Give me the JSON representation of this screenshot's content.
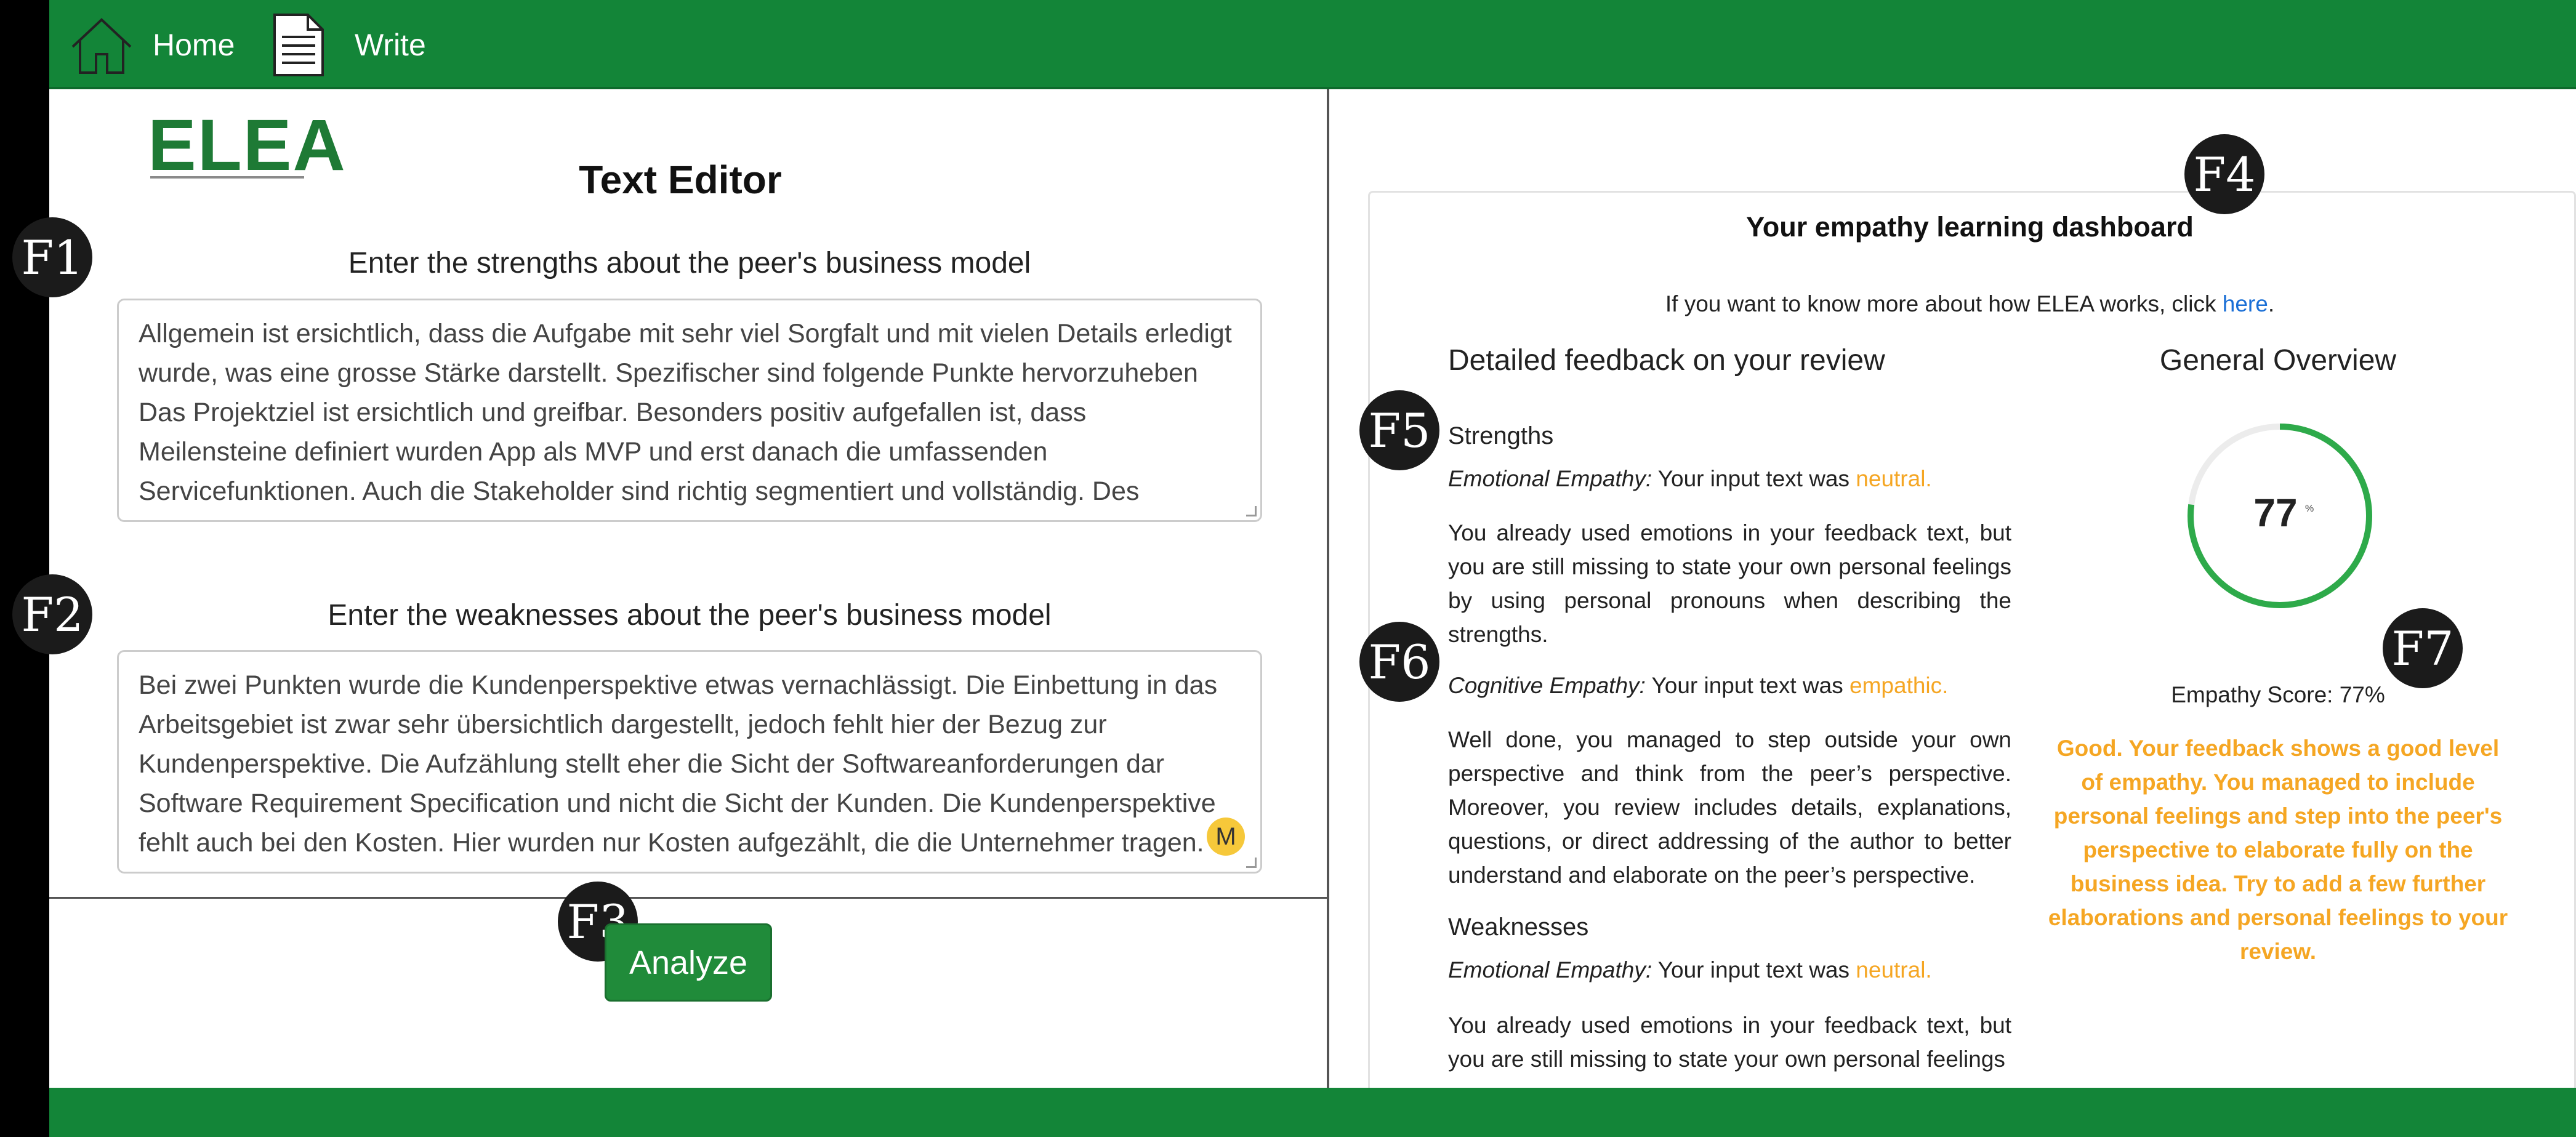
{
  "nav": {
    "home_label": "Home",
    "write_label": "Write"
  },
  "logo": {
    "text": "ELEA"
  },
  "editor": {
    "title": "Text Editor",
    "strengths_label": "Enter the strengths about the peer's business model",
    "strengths_text": "Allgemein ist ersichtlich, dass die Aufgabe mit sehr viel Sorgfalt und mit vielen Details erledigt wurde, was eine grosse Stärke darstellt. Spezifischer sind folgende Punkte hervorzuheben Das Projektziel ist ersichtlich und greifbar. Besonders positiv aufgefallen ist, dass Meilensteine definiert wurden App als MVP und erst danach die umfassenden Servicefunktionen. Auch die Stakeholder sind richtig segmentiert und vollständig. Des",
    "weaknesses_label": "Enter the weaknesses about the peer's business model",
    "weaknesses_text": "Bei zwei Punkten wurde die Kundenperspektive etwas vernachlässigt. Die Einbettung in das Arbeitsgebiet ist zwar sehr übersichtlich dargestellt, jedoch fehlt hier der Bezug zur Kundenperspektive. Die Aufzählung stellt eher die Sicht der Softwareanforderungen dar Software Requirement Specification und nicht die Sicht der Kunden. Die Kundenperspektive fehlt auch bei den Kosten. Hier wurden nur Kosten aufgezählt, die die Unternehmer tragen.",
    "analyze_label": "Analyze",
    "grammar_badge": "M"
  },
  "markers": {
    "f1": "F1",
    "f2": "F2",
    "f3": "F3",
    "f4": "F4",
    "f5": "F5",
    "f6": "F6",
    "f7": "F7"
  },
  "dashboard": {
    "title": "Your empathy learning dashboard",
    "info_prefix": "If you want to know more about how ELEA works, click ",
    "info_link": "here",
    "info_suffix": ".",
    "detailed_heading": "Detailed feedback on your review",
    "overview_heading": "General Overview",
    "strengths_heading": "Strengths",
    "strengths_emotional_label": "Emotional Empathy:",
    "strengths_emotional_prefix": "Your input text was",
    "strengths_emotional_result": "neutral.",
    "strengths_emotional_text": "You already used emotions in your feedback text, but you are still missing to state your own personal feelings by using personal pronouns when describing the strengths.",
    "strengths_cognitive_label": "Cognitive Empathy:",
    "strengths_cognitive_prefix": "Your input text was",
    "strengths_cognitive_result": "empathic.",
    "strengths_cognitive_text": "Well done, you managed to step outside your own perspective and think from the peer’s perspective. Moreover, you review includes details, explanations, questions, or direct addressing of the author to better understand and elaborate on the peer’s perspective.",
    "weaknesses_heading": "Weaknesses",
    "weaknesses_emotional_label": "Emotional Empathy:",
    "weaknesses_emotional_prefix": "Your input text was",
    "weaknesses_emotional_result": "neutral.",
    "weaknesses_emotional_text": "You already used emotions in your feedback text, but you are still missing to state your own personal feelings",
    "score_value": "77",
    "score_unit": "%",
    "score_percent": 77,
    "score_label": "Empathy Score: 77%",
    "overall_feedback": "Good. Your feedback shows a good level of empathy. You managed to include personal feelings and step into the peer's perspective to elaborate fully on the business idea. Try to add a few further elaborations and personal feelings to your review.",
    "colors": {
      "accent": "#138538",
      "result": "#f5a623",
      "gauge": "#2eaa4a",
      "link": "#1a6fd6"
    }
  }
}
